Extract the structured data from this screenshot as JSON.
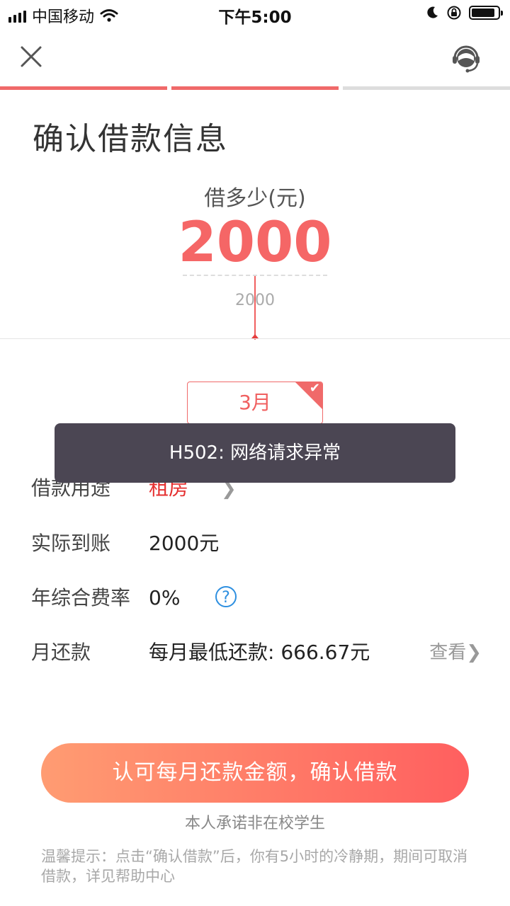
{
  "status_bar": {
    "carrier": "中国移动",
    "time": "下午5:00",
    "battery_level": 0.9
  },
  "nav": {
    "close_icon": "close-icon",
    "service_icon": "headset-icon"
  },
  "progress": {
    "total_steps": 3,
    "completed_steps": 2
  },
  "page_title": "确认借款信息",
  "amount": {
    "label": "借多少(元)",
    "value": "2000",
    "slider_value": "2000"
  },
  "term": {
    "selected": "3月"
  },
  "toast": {
    "message": "H502: 网络请求异常"
  },
  "details": {
    "purpose": {
      "label": "借款用途",
      "value": "租房"
    },
    "received": {
      "label": "实际到账",
      "value": "2000元"
    },
    "rate": {
      "label": "年综合费率",
      "value": "0%",
      "help": "?"
    },
    "monthly": {
      "label": "月还款",
      "value": "每月最低还款: 666.67元",
      "link": "查看"
    }
  },
  "confirm_button": "认可每月还款金额，确认借款",
  "pledge": "本人承诺非在校学生",
  "tip": "温馨提示：点击“确认借款”后，你有5小时的冷静期，期间可取消借款，详见帮助中心",
  "colors": {
    "accent": "#f06060",
    "amount": "#f56666",
    "progress_active": "#f06a6a",
    "progress_inactive": "#dddddd",
    "button_start": "#ff9c72",
    "button_end": "#ff5f5f"
  }
}
